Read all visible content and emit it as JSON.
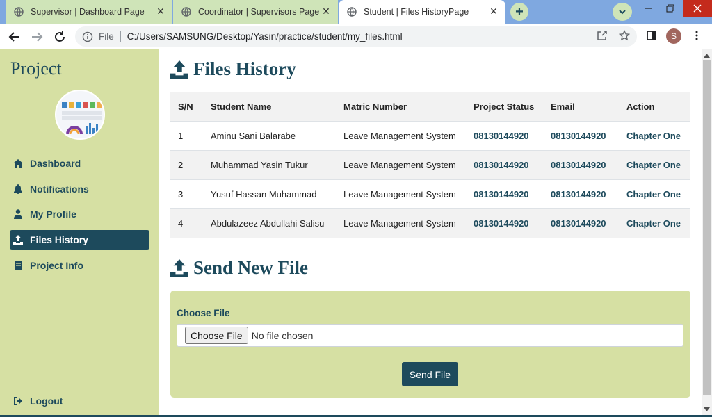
{
  "browser": {
    "tabs": [
      {
        "title": "Supervisor | Dashboard Page",
        "active": false
      },
      {
        "title": "Coordinator | Supervisors Page",
        "active": false
      },
      {
        "title": "Student | Files HistoryPage",
        "active": true
      }
    ],
    "new_tab_symbol": "+",
    "url_protocol": "File",
    "url": "C:/Users/SAMSUNG/Desktop/Yasin/practice/student/my_files.html",
    "profile_initial": "S"
  },
  "sidebar": {
    "brand": "Project",
    "items": [
      {
        "label": "Dashboard",
        "icon": "home-icon",
        "active": false
      },
      {
        "label": "Notifications",
        "icon": "bell-icon",
        "active": false
      },
      {
        "label": "My Profile",
        "icon": "user-icon",
        "active": false
      },
      {
        "label": "Files History",
        "icon": "upload-icon",
        "active": true
      },
      {
        "label": "Project Info",
        "icon": "book-icon",
        "active": false
      }
    ],
    "logout": "Logout"
  },
  "files_history": {
    "title": "Files History",
    "columns": [
      "S/N",
      "Student Name",
      "Matric Number",
      "Project Status",
      "Email",
      "Action"
    ],
    "rows": [
      [
        "1",
        "Aminu Sani Balarabe",
        "Leave Management System",
        "08130144920",
        "08130144920",
        "Chapter One"
      ],
      [
        "2",
        "Muhammad Yasin Tukur",
        "Leave Management System",
        "08130144920",
        "08130144920",
        "Chapter One"
      ],
      [
        "3",
        "Yusuf Hassan Muhammad",
        "Leave Management System",
        "08130144920",
        "08130144920",
        "Chapter One"
      ],
      [
        "4",
        "Abdulazeez Abdullahi Salisu",
        "Leave Management System",
        "08130144920",
        "08130144920",
        "Chapter One"
      ]
    ]
  },
  "send_file": {
    "title": "Send New File",
    "field_label": "Choose File",
    "choose_button": "Choose File",
    "no_file_text": "No file chosen",
    "submit": "Send File"
  },
  "colors": {
    "accent": "#1d4a5c",
    "sidebar_bg": "#d6e0a3",
    "tab_strip": "#7fa8e0"
  }
}
